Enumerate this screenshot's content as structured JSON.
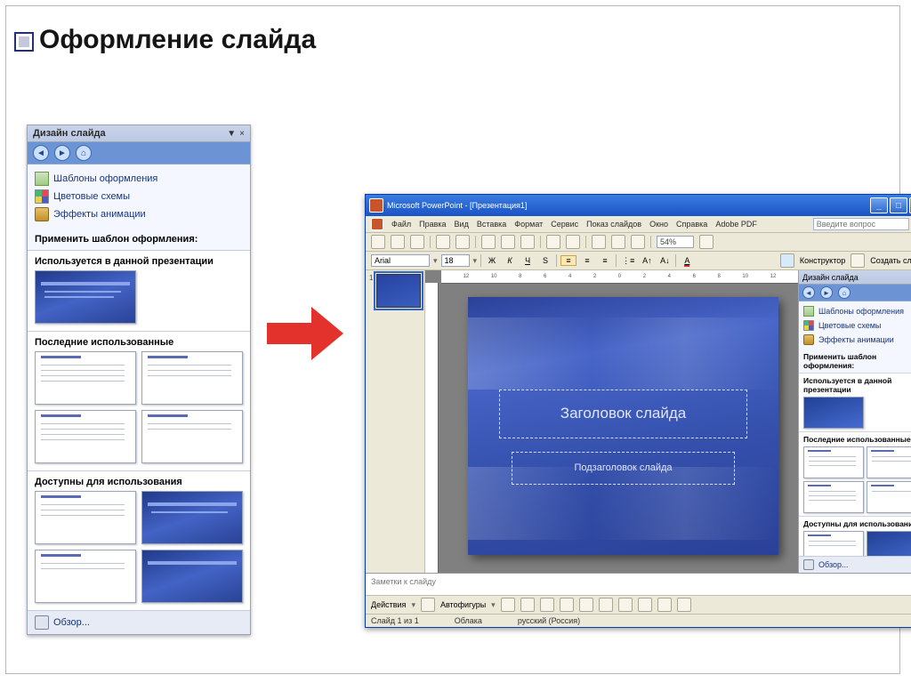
{
  "page": {
    "title": "Оформление слайда"
  },
  "taskpane": {
    "title": "Дизайн слайда",
    "links": {
      "templates": "Шаблоны оформления",
      "colors": "Цветовые схемы",
      "effects": "Эффекты анимации"
    },
    "apply_label": "Применить шаблон оформления:",
    "sections": {
      "used": "Используется в данной презентации",
      "recent": "Последние использованные",
      "available": "Доступны для использования"
    },
    "browse": "Обзор..."
  },
  "pp": {
    "title": "Microsoft PowerPoint - [Презентация1]",
    "menu": [
      "Файл",
      "Правка",
      "Вид",
      "Вставка",
      "Формат",
      "Сервис",
      "Показ слайдов",
      "Окно",
      "Справка",
      "Adobe PDF"
    ],
    "search_placeholder": "Введите вопрос",
    "zoom": "54%",
    "font": "Arial",
    "fontsize": "18",
    "fmt": {
      "bold": "Ж",
      "italic": "К",
      "underline": "Ч",
      "shadow": "S"
    },
    "designer": "Конструктор",
    "newslide": "Создать слайд",
    "slide": {
      "title_ph": "Заголовок слайда",
      "sub_ph": "Подзаголовок слайда"
    },
    "notes_ph": "Заметки к слайду",
    "drawbar": {
      "actions": "Действия",
      "autoshapes": "Автофигуры"
    },
    "status": {
      "slide": "Слайд 1 из 1",
      "design": "Облака",
      "lang": "русский (Россия)"
    },
    "taskpane": {
      "title": "Дизайн слайда",
      "links": {
        "templates": "Шаблоны оформления",
        "colors": "Цветовые схемы",
        "effects": "Эффекты анимации"
      },
      "apply_label": "Применить шаблон оформления:",
      "sections": {
        "used": "Используется в данной презентации",
        "recent": "Последние использованные",
        "available": "Доступны для использования"
      },
      "browse": "Обзор..."
    }
  }
}
